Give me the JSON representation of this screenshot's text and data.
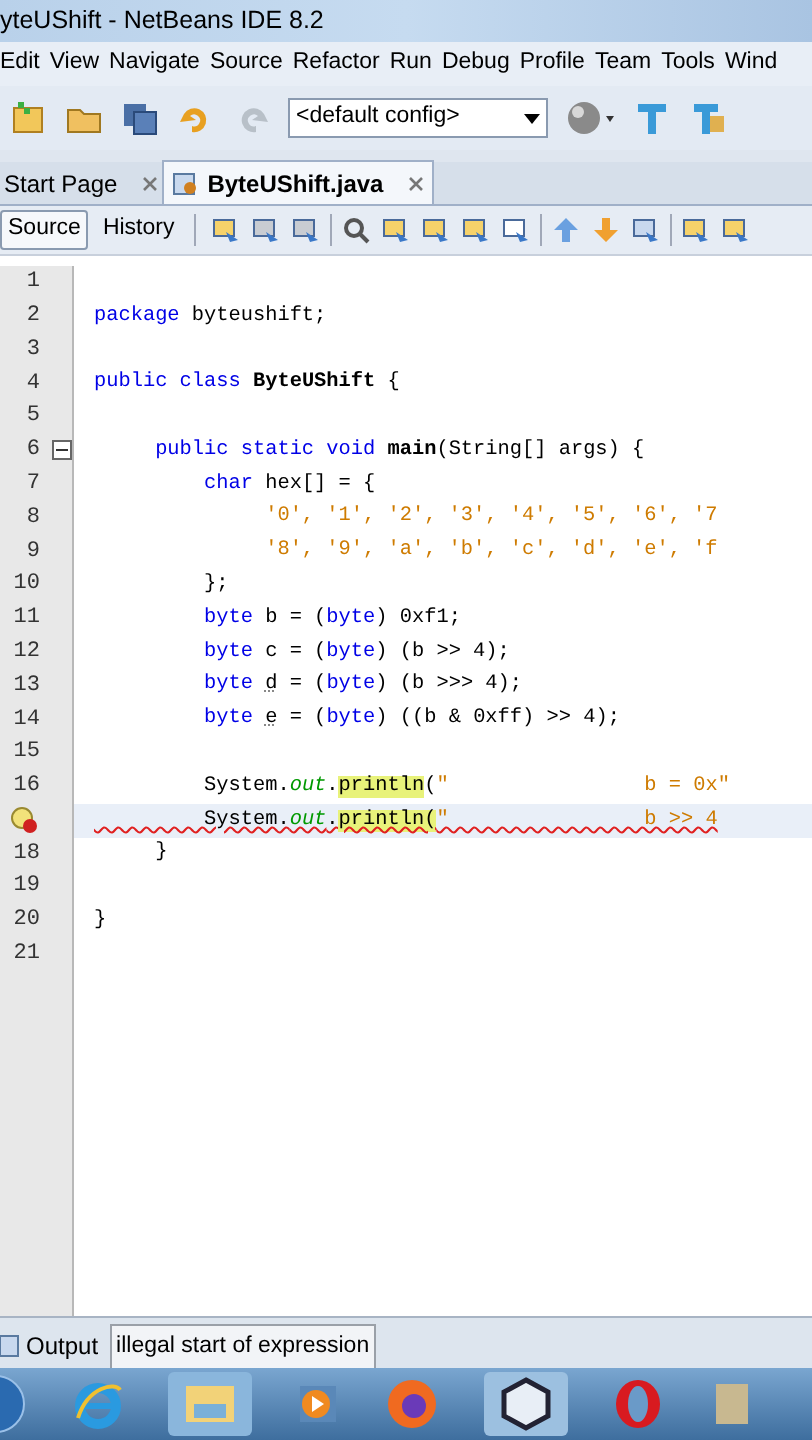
{
  "window": {
    "title": "yteUShift - NetBeans IDE 8.2"
  },
  "menu": [
    "Edit",
    "View",
    "Navigate",
    "Source",
    "Refactor",
    "Run",
    "Debug",
    "Profile",
    "Team",
    "Tools",
    "Wind"
  ],
  "toolbar": {
    "config": "<default config>"
  },
  "tabs": [
    {
      "label": "Start Page",
      "selected": false
    },
    {
      "label": "ByteUShift.java",
      "selected": true
    }
  ],
  "editor_modes": [
    {
      "label": "Source",
      "selected": true
    },
    {
      "label": "History",
      "selected": false
    }
  ],
  "lines": [
    {
      "number": "1"
    },
    {
      "number": "2",
      "tokens": [
        {
          "text": "package",
          "kind": "kw"
        },
        {
          "text": " byteushift;",
          "kind": "plain"
        }
      ]
    },
    {
      "number": "3"
    },
    {
      "number": "4",
      "tokens": [
        {
          "text": "public class ",
          "kind": "kw"
        },
        {
          "text": "ByteUShift",
          "kind": "bold"
        },
        {
          "text": " {",
          "kind": "plain"
        }
      ]
    },
    {
      "number": "5"
    },
    {
      "number": "6",
      "fold": true,
      "tokens": [
        {
          "text": "     public static void ",
          "kind": "kw"
        },
        {
          "text": "main",
          "kind": "bold"
        },
        {
          "text": "(String[] args) {",
          "kind": "plain"
        }
      ]
    },
    {
      "number": "7",
      "tokens": [
        {
          "text": "         char",
          "kind": "kw"
        },
        {
          "text": " hex[] = {",
          "kind": "plain"
        }
      ]
    },
    {
      "number": "8",
      "tokens": [
        {
          "text": "              '0', '1', '2', '3', '4', '5', '6', '7",
          "kind": "str"
        }
      ]
    },
    {
      "number": "9",
      "tokens": [
        {
          "text": "              '8', '9', 'a', 'b', 'c', 'd', 'e', 'f",
          "kind": "str"
        }
      ]
    },
    {
      "number": "10",
      "tokens": [
        {
          "text": "         };",
          "kind": "plain"
        }
      ]
    },
    {
      "number": "11",
      "tokens": [
        {
          "text": "         byte",
          "kind": "kw"
        },
        {
          "text": " b = (",
          "kind": "plain"
        },
        {
          "text": "byte",
          "kind": "kw"
        },
        {
          "text": ") 0xf1;",
          "kind": "plain"
        }
      ]
    },
    {
      "number": "12",
      "tokens": [
        {
          "text": "         byte",
          "kind": "kw"
        },
        {
          "text": " c = (",
          "kind": "plain"
        },
        {
          "text": "byte",
          "kind": "kw"
        },
        {
          "text": ") (b >> 4);",
          "kind": "plain"
        }
      ]
    },
    {
      "number": "13",
      "tokens": [
        {
          "text": "         byte ",
          "kind": "kw"
        },
        {
          "text": "d",
          "kind": "warn"
        },
        {
          "text": " = (",
          "kind": "plain"
        },
        {
          "text": "byte",
          "kind": "kw"
        },
        {
          "text": ") (b >>> 4);",
          "kind": "plain"
        }
      ]
    },
    {
      "number": "14",
      "tokens": [
        {
          "text": "         byte ",
          "kind": "kw"
        },
        {
          "text": "e",
          "kind": "warn"
        },
        {
          "text": " = (",
          "kind": "plain"
        },
        {
          "text": "byte",
          "kind": "kw"
        },
        {
          "text": ") ((b & 0xff) >> 4);",
          "kind": "plain"
        }
      ]
    },
    {
      "number": "15"
    },
    {
      "number": "16",
      "tokens": [
        {
          "text": "         System.",
          "kind": "plain"
        },
        {
          "text": "out",
          "kind": "field"
        },
        {
          "text": ".",
          "kind": "plain"
        },
        {
          "text": "println",
          "kind": "hl"
        },
        {
          "text": "(",
          "kind": "plain"
        },
        {
          "text": "\"                b = 0x\"",
          "kind": "str"
        }
      ]
    },
    {
      "current": true,
      "error": true,
      "tokens": [
        {
          "text": "         System.",
          "kind": "plain"
        },
        {
          "text": "out",
          "kind": "field"
        },
        {
          "text": ".",
          "kind": "plain"
        },
        {
          "text": "println(",
          "kind": "hl"
        },
        {
          "text": "\"                b >> 4",
          "kind": "str"
        }
      ]
    },
    {
      "number": "18",
      "tokens": [
        {
          "text": "     }",
          "kind": "plain"
        }
      ]
    },
    {
      "number": "19"
    },
    {
      "number": "20",
      "tokens": [
        {
          "text": "}",
          "kind": "plain"
        }
      ]
    },
    {
      "number": "21"
    }
  ],
  "bottom_tabs": [
    {
      "label": "Output",
      "selected": false
    },
    {
      "label": "illegal start of expression",
      "selected": true
    }
  ]
}
